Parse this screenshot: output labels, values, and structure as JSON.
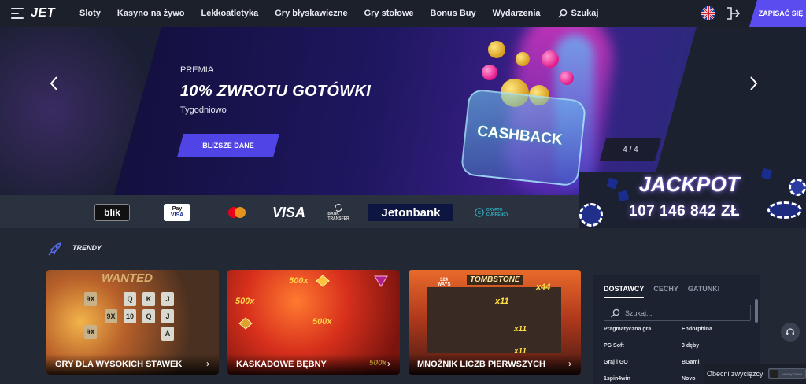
{
  "brand": {
    "logo": "JET"
  },
  "nav": {
    "items": [
      "Sloty",
      "Kasyno na żywo",
      "Lekkoatletyka",
      "Gry błyskawiczne",
      "Gry stołowe",
      "Bonus Buy",
      "Wydarzenia"
    ],
    "search_label": "Szukaj"
  },
  "header": {
    "register_label": "ZAPISAĆ SIĘ"
  },
  "promo": {
    "kicker": "PREMIA",
    "title": "10% ZWROTU GOTÓWKI",
    "subtitle": "Tygodniowo",
    "button_label": "BLIŻSZE DANE",
    "art_label": "CASHBACK",
    "slide_counter": "4 / 4"
  },
  "jackpot": {
    "title": "JACKPOT",
    "amount": "107 146 842 ZŁ"
  },
  "payments": {
    "blik": "blik",
    "apple_pay": "Pay",
    "apple_pay_sub": "VISA",
    "visa": "VISA",
    "bank_transfer": "BANK TRANSFER",
    "jetonbank": "Jetonbank",
    "crypto": "CRYPTO CURRENCY"
  },
  "trending": {
    "label": "TRENDY",
    "cards": [
      {
        "title": "GRY DLA WYSOKICH STAWEK",
        "art_title": "WANTED",
        "reels": [
          "9X",
          "Q",
          "K",
          "J",
          "9X",
          "10",
          "9X",
          "Q",
          "J",
          "A"
        ]
      },
      {
        "title": "KASKADOWE BĘBNY",
        "art_tags": [
          "500x",
          "500x",
          "500x",
          "500x"
        ]
      },
      {
        "title": "MNOŻNIK LICZB PIERWSZYCH",
        "art_title": "TOMBSTONE",
        "art_tags": [
          "324 WAYS",
          "x44",
          "x11",
          "x11",
          "x11"
        ]
      }
    ]
  },
  "providers": {
    "tabs": [
      "DOSTAWCY",
      "CECHY",
      "GATUNKI"
    ],
    "search_placeholder": "Szukaj...",
    "list": [
      "Pragmatyczna gra",
      "Endorphina",
      "PG Soft",
      "3 dęby",
      "Graj i GO",
      "BGami",
      "1spin4win",
      "Novo"
    ]
  },
  "winners": {
    "label": "Obecni zwycięzcy",
    "toggle_label": "WYŁĄCZONY"
  },
  "colors": {
    "accent": "#5b4cf0",
    "nav_bg": "#1b202a",
    "page_bg": "#222834"
  }
}
